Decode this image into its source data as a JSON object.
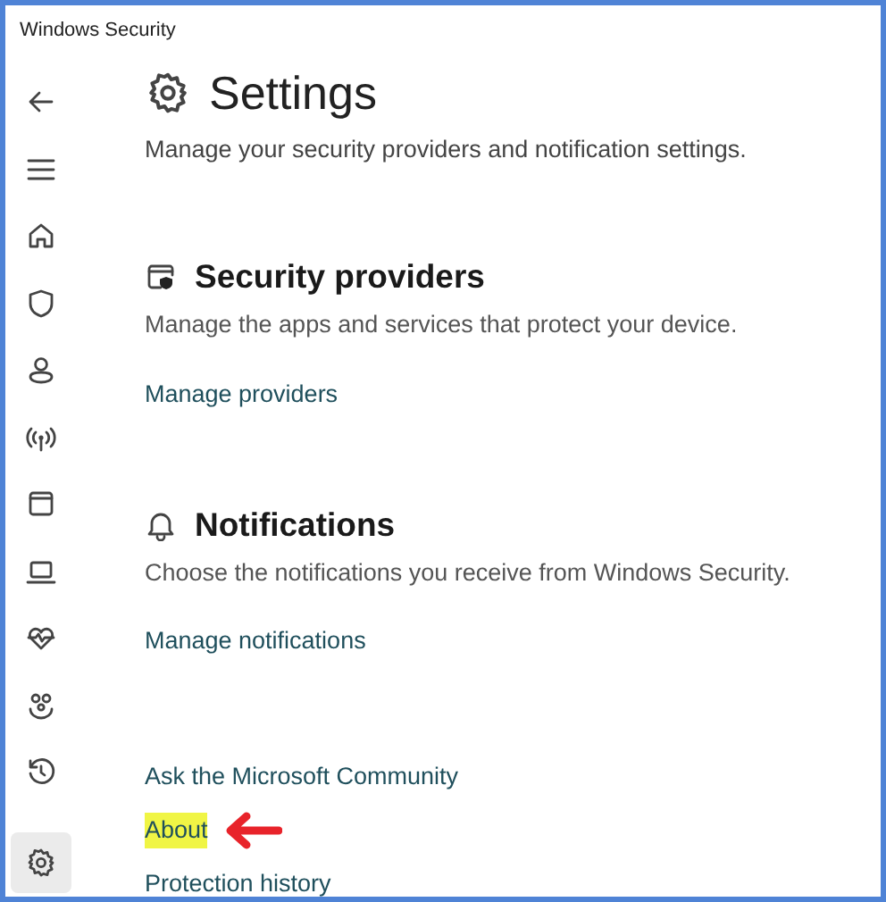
{
  "window": {
    "title": "Windows Security"
  },
  "nav": [
    {
      "kind": "back",
      "selected": false
    },
    {
      "kind": "menu",
      "selected": false
    },
    {
      "kind": "home",
      "selected": false
    },
    {
      "kind": "shield",
      "selected": false
    },
    {
      "kind": "person",
      "selected": false
    },
    {
      "kind": "wireless",
      "selected": false
    },
    {
      "kind": "window",
      "selected": false
    },
    {
      "kind": "laptop",
      "selected": false
    },
    {
      "kind": "health",
      "selected": false
    },
    {
      "kind": "family",
      "selected": false
    },
    {
      "kind": "history",
      "selected": false
    },
    {
      "kind": "settings",
      "selected": true
    }
  ],
  "page": {
    "title": "Settings",
    "subtitle": "Manage your security providers and notification settings."
  },
  "sections": [
    {
      "kind": "providers",
      "title": "Security providers",
      "description": "Manage the apps and services that protect your device.",
      "link": "Manage providers"
    },
    {
      "kind": "notifications",
      "title": "Notifications",
      "description": "Choose the notifications you receive from Windows Security.",
      "link": "Manage notifications"
    }
  ],
  "links": [
    {
      "label": "Ask the Microsoft Community",
      "highlighted": false
    },
    {
      "label": "About",
      "highlighted": true
    },
    {
      "label": "Protection history",
      "highlighted": false
    }
  ]
}
